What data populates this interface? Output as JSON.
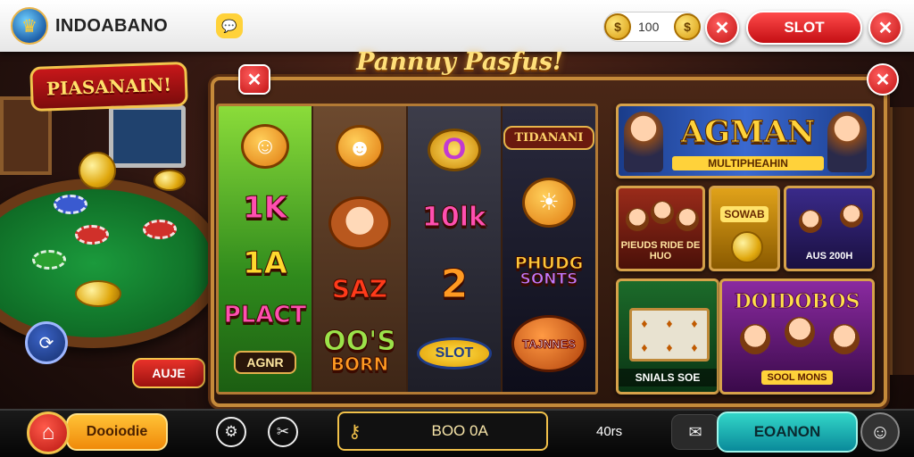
{
  "header": {
    "brand": "INDOABANO",
    "coins_value": "100",
    "slot_button": "SLOT",
    "icons": [
      "app-logo-icon",
      "chat-bubble-icon",
      "coin-icon",
      "close-icon"
    ]
  },
  "background": {
    "banner": "PIASANAIN!",
    "side_button": "AUJE"
  },
  "panel": {
    "title": "Pannuy Pasfus!",
    "reels": [
      {
        "top": "face-symbol",
        "sym1": "1K",
        "sym2": "1A",
        "sym3": "PLACT",
        "plate": "AGNR"
      },
      {
        "sym1": "SAZ",
        "sym2": "OO'S",
        "sym2b": "BORN"
      },
      {
        "top": "O",
        "sym1": "10lk",
        "sym2": "2",
        "sym3": "SLOT"
      },
      {
        "top": "TIDANANI",
        "sym1": "PHUDG",
        "sym1b": "SONTS",
        "sym2": "TAJNNES"
      }
    ]
  },
  "tiles": {
    "feature_title": "AGMAN",
    "feature_sub": "MULTIPHEAHIN",
    "tile_a": "PIEUDS RIDE DE HUO",
    "tile_b": "SOWAB",
    "tile_c": "AUS 200H",
    "tile_d": "SNIALS SOE",
    "tile_e_title": "DOIDOBOS",
    "tile_e_cap": "SOOL MONS"
  },
  "bottom": {
    "orange_button": "Dooiodie",
    "search_value": "BOO 0A",
    "count": "40rs",
    "teal_button": "EOANON"
  },
  "colors": {
    "gold": "#f1c14a",
    "red": "#c21414",
    "teal": "#32d6c8",
    "felt": "#1b9a3c"
  }
}
